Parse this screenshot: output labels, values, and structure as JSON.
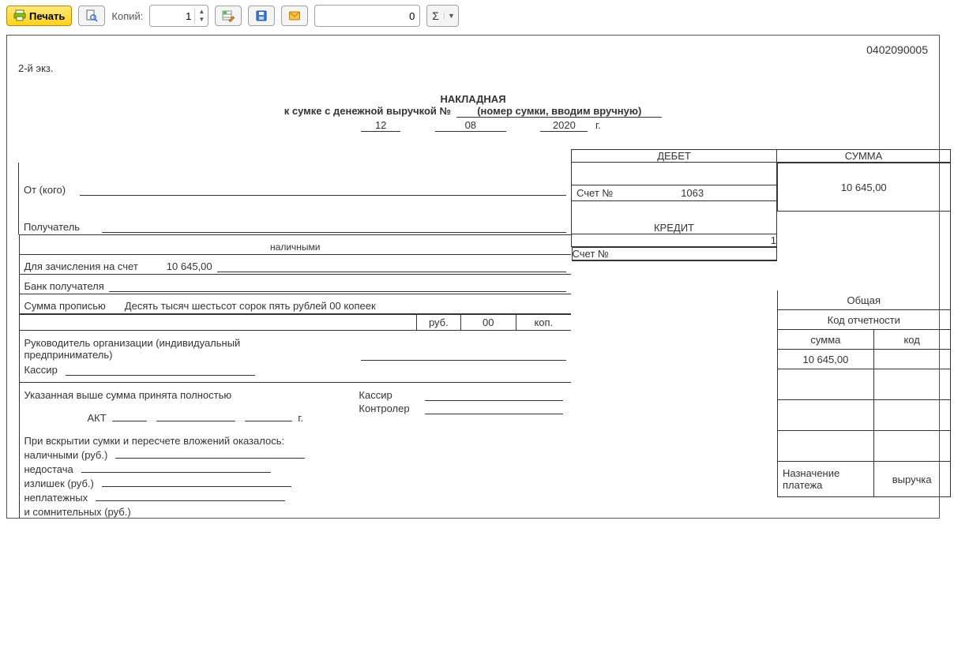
{
  "toolbar": {
    "print": "Печать",
    "copies_label": "Копий:",
    "copies_value": "1",
    "num_value": "0"
  },
  "form_number": "0402090005",
  "ekz": "2-й экз.",
  "title": {
    "line1": "НАКЛАДНАЯ",
    "line2_prefix": "к сумке с денежной выручкой №",
    "bag_no": "(номер сумки, вводим вручную)",
    "day": "12",
    "month": "08",
    "year": "2020",
    "year_suffix": "г."
  },
  "labels": {
    "debet": "ДЕБЕТ",
    "summa": "СУММА",
    "from": "От (кого)",
    "account_no": "Счет №",
    "recipient": "Получатель",
    "credit": "КРЕДИТ",
    "cash": "наличными",
    "to_account": "Для зачисления на счет",
    "recipient_bank": "Банк получателя",
    "sum_words": "Сумма прописью",
    "rub": "руб.",
    "kop": "коп.",
    "obshaya": "Общая",
    "kod_otch": "Код отчетности",
    "summa_col": "сумма",
    "kod_col": "код",
    "head": "Руководитель организации (индивидуальный предприниматель)",
    "cashier": "Кассир",
    "accepted": "Указанная выше сумма принята полностью",
    "cashier2": "Кассир",
    "controller": "Контролер",
    "act": "АКТ",
    "act_g": "г.",
    "on_open": "При вскрытии сумки и пересчете вложений оказалось:",
    "cash_rub": "наличными (руб.)",
    "shortage": "недостача",
    "surplus": "излишек (руб.)",
    "nonpay": "неплатежных",
    "doubtful": "и сомнительных (руб.)",
    "purpose": "Назначение платежа",
    "vyruchka": "выручка"
  },
  "values": {
    "summa": "10 645,00",
    "debit_account": "1063",
    "credit_flag": "1",
    "credit_account": "",
    "to_account_sum": "10 645,00",
    "sum_words": "Десять тысяч шестьсот сорок пять рублей 00 копеек",
    "kop": "00",
    "summa2": "10 645,00"
  }
}
